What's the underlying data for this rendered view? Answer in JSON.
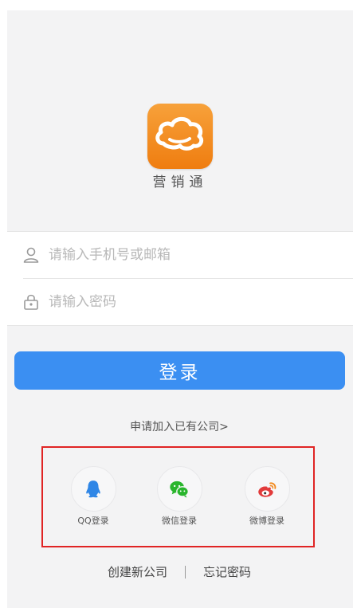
{
  "app": {
    "name": "营销通"
  },
  "form": {
    "account_placeholder": "请输入手机号或邮箱",
    "password_placeholder": "请输入密码",
    "account_value": "",
    "password_value": ""
  },
  "login_button": "登录",
  "join_company_link": "申请加入已有公司>",
  "social": [
    {
      "label": "QQ登录",
      "icon": "qq-icon",
      "color": "#2f86e6"
    },
    {
      "label": "微信登录",
      "icon": "wechat-icon",
      "color": "#29b52c"
    },
    {
      "label": "微博登录",
      "icon": "weibo-icon",
      "color": "#e23b3b"
    }
  ],
  "footer": {
    "create_company": "创建新公司",
    "forgot_password": "忘记密码"
  },
  "colors": {
    "primary": "#3b8ff2",
    "logo_orange": "#f28a1e",
    "highlight": "#e02424",
    "background": "#f3f3f4"
  }
}
